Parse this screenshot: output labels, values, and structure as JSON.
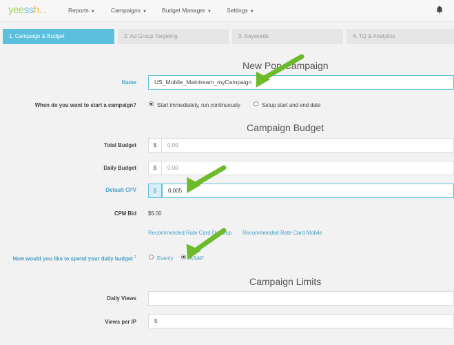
{
  "brand": {
    "logo_part1": "yee",
    "logo_part2": "ss",
    "logo_part3": "h..."
  },
  "nav": {
    "items": [
      {
        "label": "Reports"
      },
      {
        "label": "Campaigns"
      },
      {
        "label": "Budget Manager"
      },
      {
        "label": "Settings"
      }
    ]
  },
  "steps": [
    {
      "label": "1. Campaign & Budget",
      "active": true
    },
    {
      "label": "2. Ad Group Targeting"
    },
    {
      "label": "3. Keywords"
    },
    {
      "label": "4. TQ & Analytics"
    }
  ],
  "campaign": {
    "title": "New Pop Campaign",
    "name_label": "Name",
    "name_value": "US_Mobile_Maintream_myCampaign",
    "start_label": "When do you want to start a campaign?",
    "start_option1": "Start immediately, run continuously",
    "start_option2": "Setup start and end date"
  },
  "budget": {
    "title": "Campaign Budget",
    "total_label": "Total Budget",
    "total_currency": "$",
    "total_value": "0.00",
    "daily_label": "Daily Budget",
    "daily_currency": "$",
    "daily_value": "0.00",
    "cpv_label": "Default CPV",
    "cpv_currency": "$",
    "cpv_value": "0,005",
    "cpm_label": "CPM Bid",
    "cpm_value": "$5.00",
    "rate_card_desktop": "Recommended Rate Card Desktop",
    "rate_card_mobile": "Recommended Rate Card Mobile",
    "spend_label": "How would you like to spend your daily budget",
    "spend_hint": "?",
    "spend_option1": "Evenly",
    "spend_option2": "ASAP"
  },
  "limits": {
    "title": "Campaign Limits",
    "daily_views_label": "Daily Views",
    "daily_views_value": "",
    "views_per_ip_label": "Views per IP",
    "views_per_ip_value": "5"
  },
  "colors": {
    "accent": "#5bc0de",
    "arrow": "#6dbb2a",
    "label_blue": "#4a9fc9"
  },
  "icons": {
    "notifications": "bell-icon",
    "annotation": "arrow-icon"
  }
}
